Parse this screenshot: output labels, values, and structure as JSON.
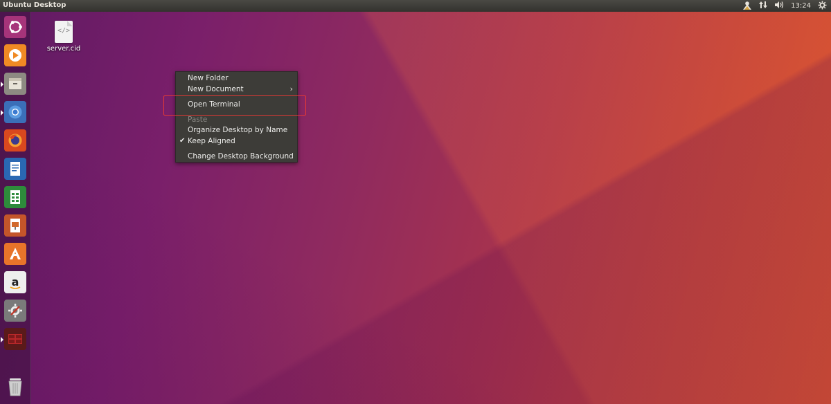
{
  "panel": {
    "title": "Ubuntu Desktop",
    "clock": "13:24"
  },
  "launcher": {
    "items": [
      {
        "name": "ubuntu-dash",
        "icon": "ubuntu-logo-icon"
      },
      {
        "name": "rhythmbox",
        "icon": "media-player-icon"
      },
      {
        "name": "files",
        "icon": "file-cabinet-icon"
      },
      {
        "name": "chromium",
        "icon": "chromium-icon"
      },
      {
        "name": "firefox",
        "icon": "firefox-icon"
      },
      {
        "name": "writer",
        "icon": "text-document-icon"
      },
      {
        "name": "calc",
        "icon": "spreadsheet-icon"
      },
      {
        "name": "impress",
        "icon": "presentation-icon"
      },
      {
        "name": "software",
        "icon": "software-center-icon"
      },
      {
        "name": "amazon",
        "icon": "amazon-icon"
      },
      {
        "name": "settings",
        "icon": "system-settings-icon"
      },
      {
        "name": "workspaces",
        "icon": "workspace-switcher-icon"
      },
      {
        "name": "trash",
        "icon": "trash-icon"
      }
    ]
  },
  "desktop": {
    "file_label": "server.cid",
    "file_glyph": "</>"
  },
  "menu": {
    "items": [
      {
        "label": "New Folder",
        "enabled": true
      },
      {
        "label": "New Document",
        "enabled": true,
        "submenu_arrow": "›"
      },
      {
        "label": "Open Terminal",
        "enabled": true,
        "highlighted": true
      },
      {
        "label": "Paste",
        "enabled": false
      },
      {
        "label": "Organize Desktop by Name",
        "enabled": true
      },
      {
        "label": "Keep Aligned",
        "enabled": true,
        "checked": true,
        "check_glyph": "✔"
      },
      {
        "label": "Change Desktop Background",
        "enabled": true
      }
    ]
  },
  "colors": {
    "highlight_border": "#e53935",
    "menu_bg": "#3d3c38"
  }
}
